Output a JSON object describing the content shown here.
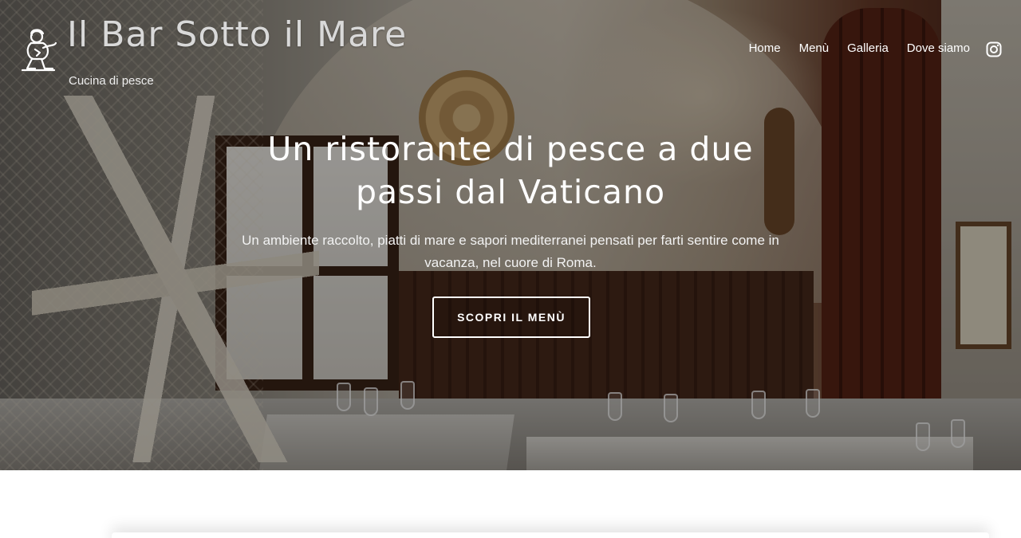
{
  "site": {
    "title": "Il Bar Sotto il Mare",
    "tagline": "Cucina di pesce"
  },
  "nav": {
    "items": [
      {
        "label": "Home"
      },
      {
        "label": "Menù"
      },
      {
        "label": "Galleria"
      },
      {
        "label": "Dove siamo"
      }
    ],
    "social_icon": "instagram-icon"
  },
  "hero": {
    "headline": "Un ristorante di pesce a due passi dal Vaticano",
    "subtext": "Un ambiente raccolto, piatti di mare e sapori mediterranei pensati per farti sentire come in vacanza, nel cuore di Roma.",
    "cta_label": "SCOPRI IL MENÙ"
  },
  "colors": {
    "overlay": "#000000",
    "text": "#ffffff",
    "title": "#d9d9d9"
  }
}
